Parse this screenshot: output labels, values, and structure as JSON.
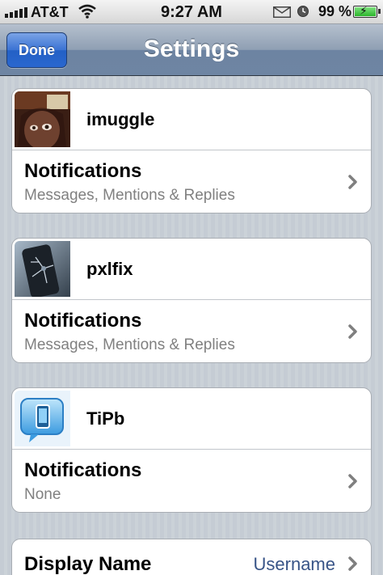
{
  "status_bar": {
    "carrier": "AT&T",
    "time": "9:27 AM",
    "battery_percent": "99 %",
    "icons": [
      "signal-bars-icon",
      "wifi-icon",
      "mail-icon",
      "alarm-icon",
      "battery-charging-icon"
    ]
  },
  "nav": {
    "title": "Settings",
    "done_label": "Done"
  },
  "accounts": [
    {
      "name": "imuggle",
      "avatar": "user-photo-avatar",
      "notifications_label": "Notifications",
      "notifications_detail": "Messages, Mentions & Replies"
    },
    {
      "name": "pxlfix",
      "avatar": "cracked-phone-avatar",
      "notifications_label": "Notifications",
      "notifications_detail": "Messages, Mentions & Replies"
    },
    {
      "name": "TiPb",
      "avatar": "tipb-logo-avatar",
      "notifications_label": "Notifications",
      "notifications_detail": "None"
    }
  ],
  "display_name": {
    "label": "Display Name",
    "value": "Username"
  },
  "colors": {
    "nav_bar": "#6d84a2",
    "done_button": "#2a67cf",
    "detail_value": "#385487",
    "subtitle": "#808080",
    "background_stripes": "#c5ccd4"
  }
}
